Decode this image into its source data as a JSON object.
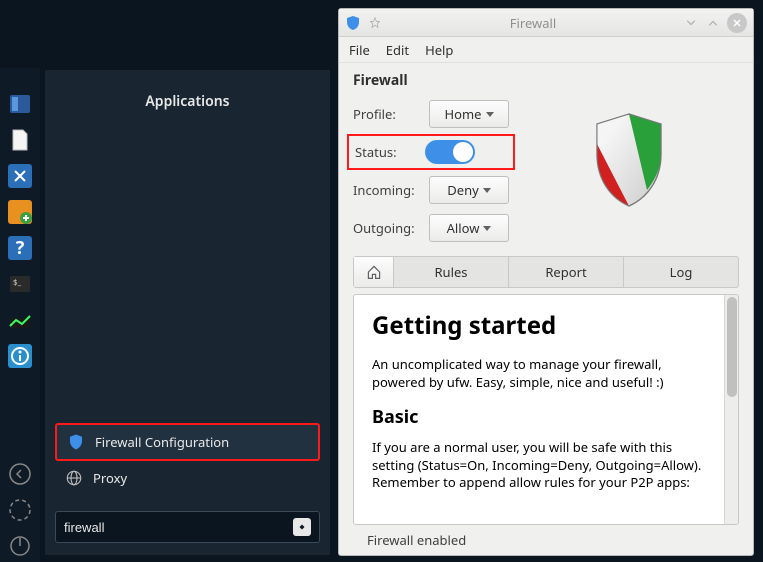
{
  "taskbar": {
    "items": [
      {
        "name": "files",
        "color1": "#3a78cc",
        "color2": "#2a5a99"
      },
      {
        "name": "document",
        "color1": "#ffffff",
        "color2": "#eaeaea"
      },
      {
        "name": "tools",
        "color1": "#2a6fb8",
        "color2": "#1a4d82"
      },
      {
        "name": "download",
        "color1": "#e89020",
        "color2": "#3aa040"
      },
      {
        "name": "help",
        "color1": "#2a6fb8",
        "color2": "#1a4d82"
      },
      {
        "name": "terminal",
        "color1": "#2a2a2a",
        "color2": "#181818"
      },
      {
        "name": "monitor",
        "color1": "#3aa040",
        "color2": "#2a7a30"
      },
      {
        "name": "info",
        "color1": "#2a8fcc",
        "color2": "#1a6a99"
      }
    ],
    "bottom": [
      {
        "name": "back"
      },
      {
        "name": "reload"
      },
      {
        "name": "power"
      }
    ]
  },
  "kickoff": {
    "header": "Applications",
    "items": [
      {
        "label": "Firewall Configuration",
        "selected": true
      },
      {
        "label": "Proxy",
        "selected": false
      }
    ],
    "search_value": "firewall"
  },
  "firewall": {
    "window_title": "Firewall",
    "menu": {
      "file": "File",
      "edit": "Edit",
      "help": "Help"
    },
    "section_title": "Firewall",
    "form": {
      "profile_label": "Profile:",
      "profile_value": "Home",
      "status_label": "Status:",
      "status_on": true,
      "incoming_label": "Incoming:",
      "incoming_value": "Deny",
      "outgoing_label": "Outgoing:",
      "outgoing_value": "Allow"
    },
    "tabs": {
      "home": "⌂",
      "rules": "Rules",
      "report": "Report",
      "log": "Log"
    },
    "info": {
      "h1": "Getting started",
      "p1": "An uncomplicated way to manage your firewall, powered by ufw. Easy, simple, nice and useful! :)",
      "h2": "Basic",
      "p2": "If you are a normal user, you will be safe with this setting (Status=On, Incoming=Deny, Outgoing=Allow). Remember to append allow rules for your P2P apps:"
    },
    "status_line": "Firewall enabled"
  }
}
